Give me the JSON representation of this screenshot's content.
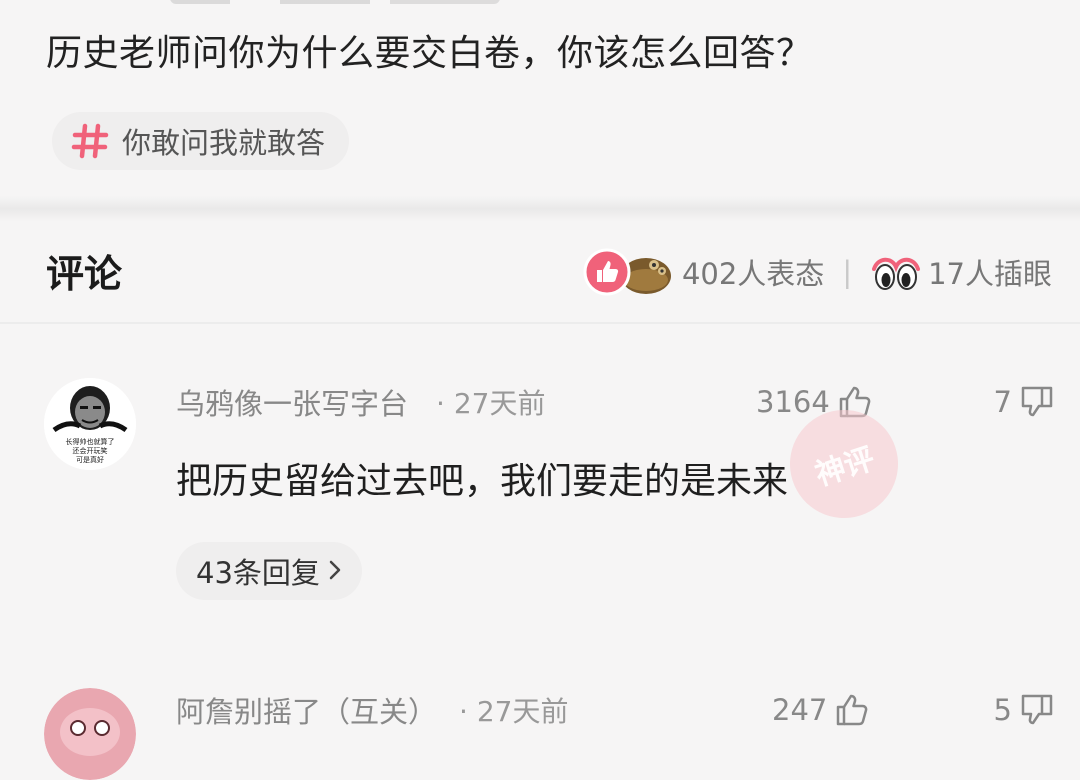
{
  "question": {
    "title": "历史老师问你为什么要交白卷，你该怎么回答？"
  },
  "topic": {
    "label": "你敢问我就敢答"
  },
  "comments_header": {
    "title": "评论",
    "reactions_text": "402人表态",
    "eyes_text": "17人插眼"
  },
  "comments": [
    {
      "username": "乌鸦像一张写字台",
      "time": "· 27天前",
      "likes": "3164",
      "dislikes": "7",
      "text": "把历史留给过去吧，我们要走的是未来",
      "replies": "43条回复",
      "avatar_caption": "长得帅也就算了 还会开玩笑 可是真好"
    },
    {
      "username": "阿詹别摇了（互关）",
      "time": "· 27天前",
      "likes": "247",
      "dislikes": "5"
    }
  ],
  "colors": {
    "accent_pink": "#f0627a",
    "background": "#f6f5f5",
    "pill_bg": "#efeeee"
  },
  "icons": {
    "topic": "hash-icon",
    "like": "thumb-up-icon",
    "dislike": "thumb-down-icon",
    "reaction_like": "like-badge-icon",
    "reaction_meme": "meme-face-icon",
    "eyes": "eyes-icon",
    "chevron": "chevron-right-icon"
  }
}
